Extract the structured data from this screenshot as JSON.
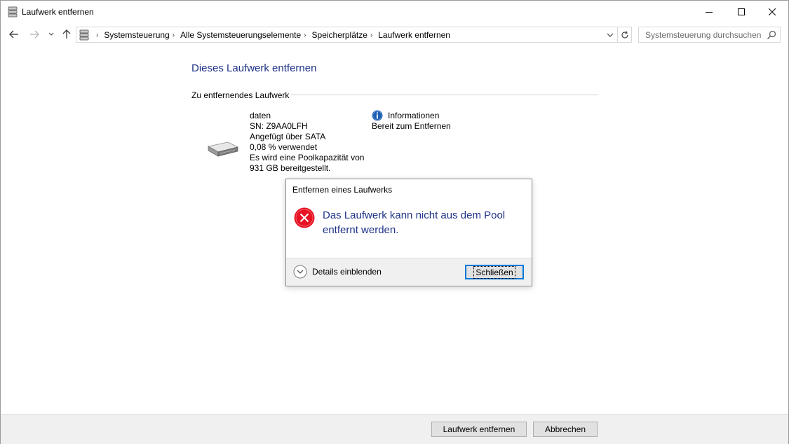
{
  "window": {
    "title": "Laufwerk entfernen",
    "controls": {
      "minimize": "minimize",
      "maximize": "maximize",
      "close": "close"
    }
  },
  "navigation": {
    "breadcrumbs": [
      "Systemsteuerung",
      "Alle Systemsteuerungselemente",
      "Speicherplätze",
      "Laufwerk entfernen"
    ],
    "search_placeholder": "Systemsteuerung durchsuchen"
  },
  "main": {
    "page_title": "Dieses Laufwerk entfernen",
    "section_header": "Zu entfernendes Laufwerk",
    "drive": {
      "name": "daten",
      "serial": "SN: Z9AA0LFH",
      "connection": "Angefügt über SATA",
      "usage": "0,08 % verwendet",
      "capacity_line1": "Es wird eine Poolkapazität von",
      "capacity_line2": "931 GB bereitgestellt."
    },
    "status": {
      "label": "Informationen",
      "value": "Bereit zum Entfernen"
    }
  },
  "dialog": {
    "title": "Entfernen eines Laufwerks",
    "message": "Das Laufwerk kann nicht aus dem Pool entfernt werden.",
    "details_label": "Details einblenden",
    "close_label": "Schließen"
  },
  "footer": {
    "remove_label": "Laufwerk entfernen",
    "cancel_label": "Abbrechen"
  },
  "colors": {
    "title_blue": "#1e3287",
    "error_red": "#e81123",
    "info_blue": "#1c5fb5",
    "focus_blue": "#0078d7"
  },
  "icons": {
    "title": "storage-spaces-icon",
    "info": "info-icon",
    "error": "error-icon",
    "drive": "hard-drive-icon"
  }
}
